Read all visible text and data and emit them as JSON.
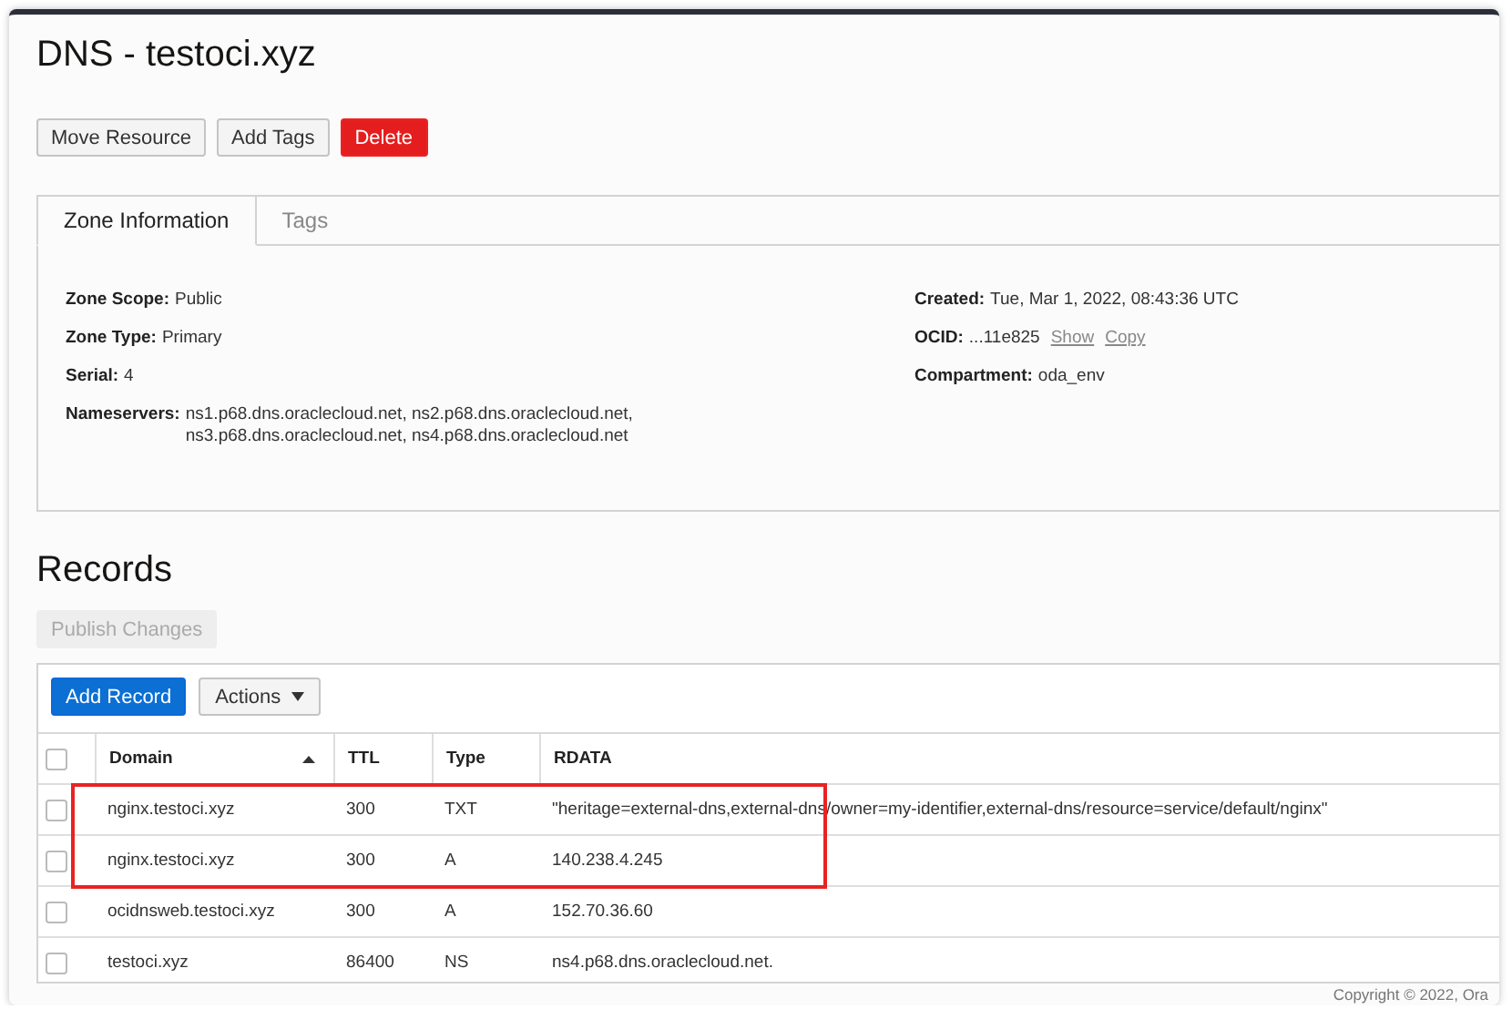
{
  "page": {
    "title": "DNS - testoci.xyz"
  },
  "actions": [
    {
      "label": "Move Resource",
      "kind": "default"
    },
    {
      "label": "Add Tags",
      "kind": "default"
    },
    {
      "label": "Delete",
      "kind": "danger"
    }
  ],
  "tabs": [
    {
      "label": "Zone Information",
      "selected": true
    },
    {
      "label": "Tags",
      "selected": false
    }
  ],
  "zone_info": {
    "left": [
      {
        "label": "Zone Scope:",
        "value": "Public"
      },
      {
        "label": "Zone Type:",
        "value": "Primary"
      },
      {
        "label": "Serial:",
        "value": "4"
      },
      {
        "label": "Nameservers:",
        "value": "ns1.p68.dns.oraclecloud.net, ns2.p68.dns.oraclecloud.net, ns3.p68.dns.oraclecloud.net, ns4.p68.dns.oraclecloud.net"
      }
    ],
    "right": [
      {
        "label": "Created:",
        "value": "Tue, Mar 1, 2022, 08:43:36 UTC"
      },
      {
        "label": "OCID:",
        "value": "...11e825",
        "links": [
          "Show",
          "Copy"
        ]
      },
      {
        "label": "Compartment:",
        "value": "oda_env"
      }
    ]
  },
  "records": {
    "title": "Records",
    "publish": {
      "label": "Publish Changes",
      "disabled": true
    },
    "add_button": "Add Record",
    "actions_menu": "Actions",
    "select_all_checked": false,
    "columns": [
      {
        "label": "Domain",
        "sorted": true
      },
      {
        "label": "TTL",
        "sorted": false
      },
      {
        "label": "Type",
        "sorted": false
      },
      {
        "label": "RDATA",
        "sorted": false
      }
    ],
    "rows": [
      {
        "domain": "nginx.testoci.xyz",
        "ttl": "300",
        "type": "TXT",
        "rdata": "\"heritage=external-dns,external-dns/owner=my-identifier,external-dns/resource=service/default/nginx\"",
        "checked": false,
        "highlighted": true
      },
      {
        "domain": "nginx.testoci.xyz",
        "ttl": "300",
        "type": "A",
        "rdata": "140.238.4.245",
        "checked": false,
        "highlighted": true
      },
      {
        "domain": "ocidnsweb.testoci.xyz",
        "ttl": "300",
        "type": "A",
        "rdata": "152.70.36.60",
        "checked": false,
        "highlighted": false
      },
      {
        "domain": "testoci.xyz",
        "ttl": "86400",
        "type": "NS",
        "rdata": "ns4.p68.dns.oraclecloud.net.",
        "checked": false,
        "highlighted": false
      }
    ]
  },
  "footer": {
    "copyright": "Copyright © 2022, Ora"
  }
}
